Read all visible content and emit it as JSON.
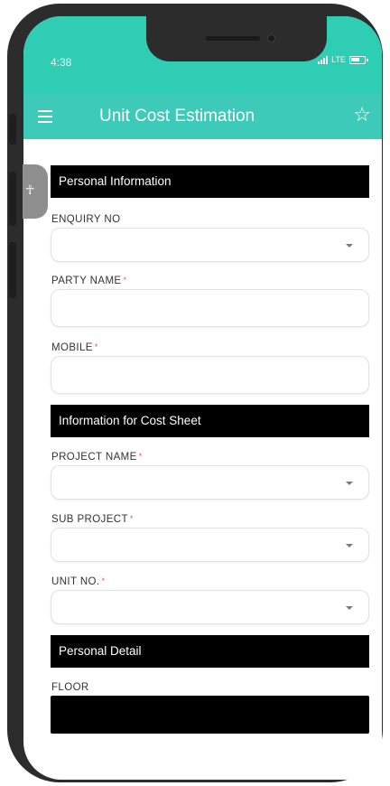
{
  "status_bar": {
    "time": "4:38",
    "network": "LTE",
    "color": "#2ecdb4"
  },
  "app_bar": {
    "title": "Unit Cost Estimation",
    "menu_icon": "hamburger-menu-icon",
    "favorite_icon": "star-outline-icon",
    "color": "#3ecab8"
  },
  "accessibility": {
    "icon": "accessibility-person-icon",
    "glyph": "☥"
  },
  "sections": {
    "personal_information": "Personal Information",
    "cost_sheet": "Information for Cost Sheet",
    "personal_detail": "Personal Detail"
  },
  "fields": {
    "enquiry_no": {
      "label": "ENQUIRY NO",
      "value": "",
      "required": false
    },
    "party_name": {
      "label": "PARTY NAME",
      "value": "",
      "required": true
    },
    "mobile": {
      "label": "MOBILE",
      "value": "",
      "required": true
    },
    "project_name": {
      "label": "PROJECT NAME",
      "value": "",
      "required": true
    },
    "sub_project": {
      "label": "SUB PROJECT",
      "value": "",
      "required": true
    },
    "unit_no": {
      "label": "UNIT NO.",
      "value": "",
      "required": true
    },
    "floor": {
      "label": "FLOOR",
      "value": ""
    }
  },
  "required_marker": "*",
  "colors": {
    "accent": "#3ecab8",
    "section_bar": "#000000",
    "required": "#e05a5a"
  }
}
